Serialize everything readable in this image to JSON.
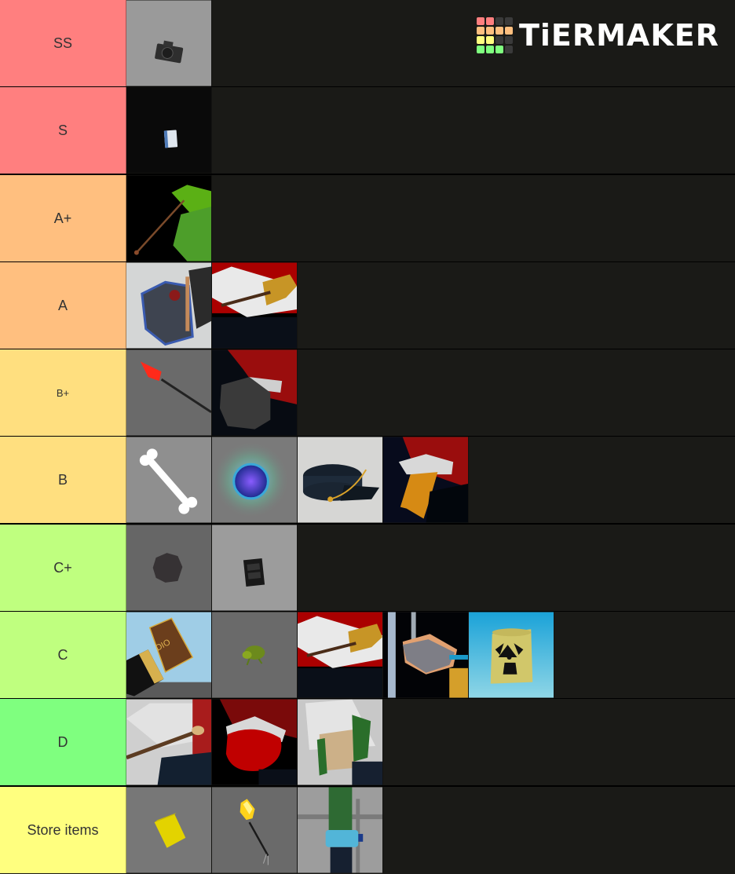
{
  "logo": {
    "text": "TiERMAKER",
    "grid_colors": [
      "#ff7f7f",
      "#ff7f7f",
      "#3a3a3a",
      "#3a3a3a",
      "#ffbf7f",
      "#ffbf7f",
      "#ffbf7f",
      "#ffbf7f",
      "#ffff7f",
      "#ffff7f",
      "#3a3a3a",
      "#3a3a3a",
      "#7fff7f",
      "#7fff7f",
      "#7fff7f",
      "#3a3a3a"
    ]
  },
  "tiers": [
    {
      "label": "SS",
      "color": "#ff7f7f",
      "items": [
        "camera"
      ]
    },
    {
      "label": "S",
      "color": "#ff7f7f",
      "items": [
        "book"
      ]
    },
    {
      "label": "A+",
      "color": "#ffbf7f",
      "items": [
        "green-arrow"
      ]
    },
    {
      "label": "A",
      "color": "#ffbf7f",
      "items": [
        "stone-mask",
        "paint-palette"
      ]
    },
    {
      "label": "B+",
      "color": "#ffdf7f",
      "items": [
        "red-arrow",
        "gray-stone-hand"
      ]
    },
    {
      "label": "B",
      "color": "#ffdf7f",
      "items": [
        "bone",
        "blue-orb",
        "cap",
        "orange-cloth-hand"
      ]
    },
    {
      "label": "C+",
      "color": "#bfff7f",
      "items": [
        "dark-rock",
        "cassette"
      ]
    },
    {
      "label": "C",
      "color": "#bfff7f",
      "items": [
        "dio-diary",
        "frog",
        "paint-palette-2",
        "rock-hand",
        "radioactive-barrel"
      ]
    },
    {
      "label": "D",
      "color": "#7fff7f",
      "items": [
        "wooden-stick",
        "red-blob",
        "green-boot"
      ]
    },
    {
      "label": "Store items",
      "color": "#ffff7f",
      "items": [
        "yellow-block",
        "torch-arrow",
        "water-bottle"
      ]
    }
  ]
}
